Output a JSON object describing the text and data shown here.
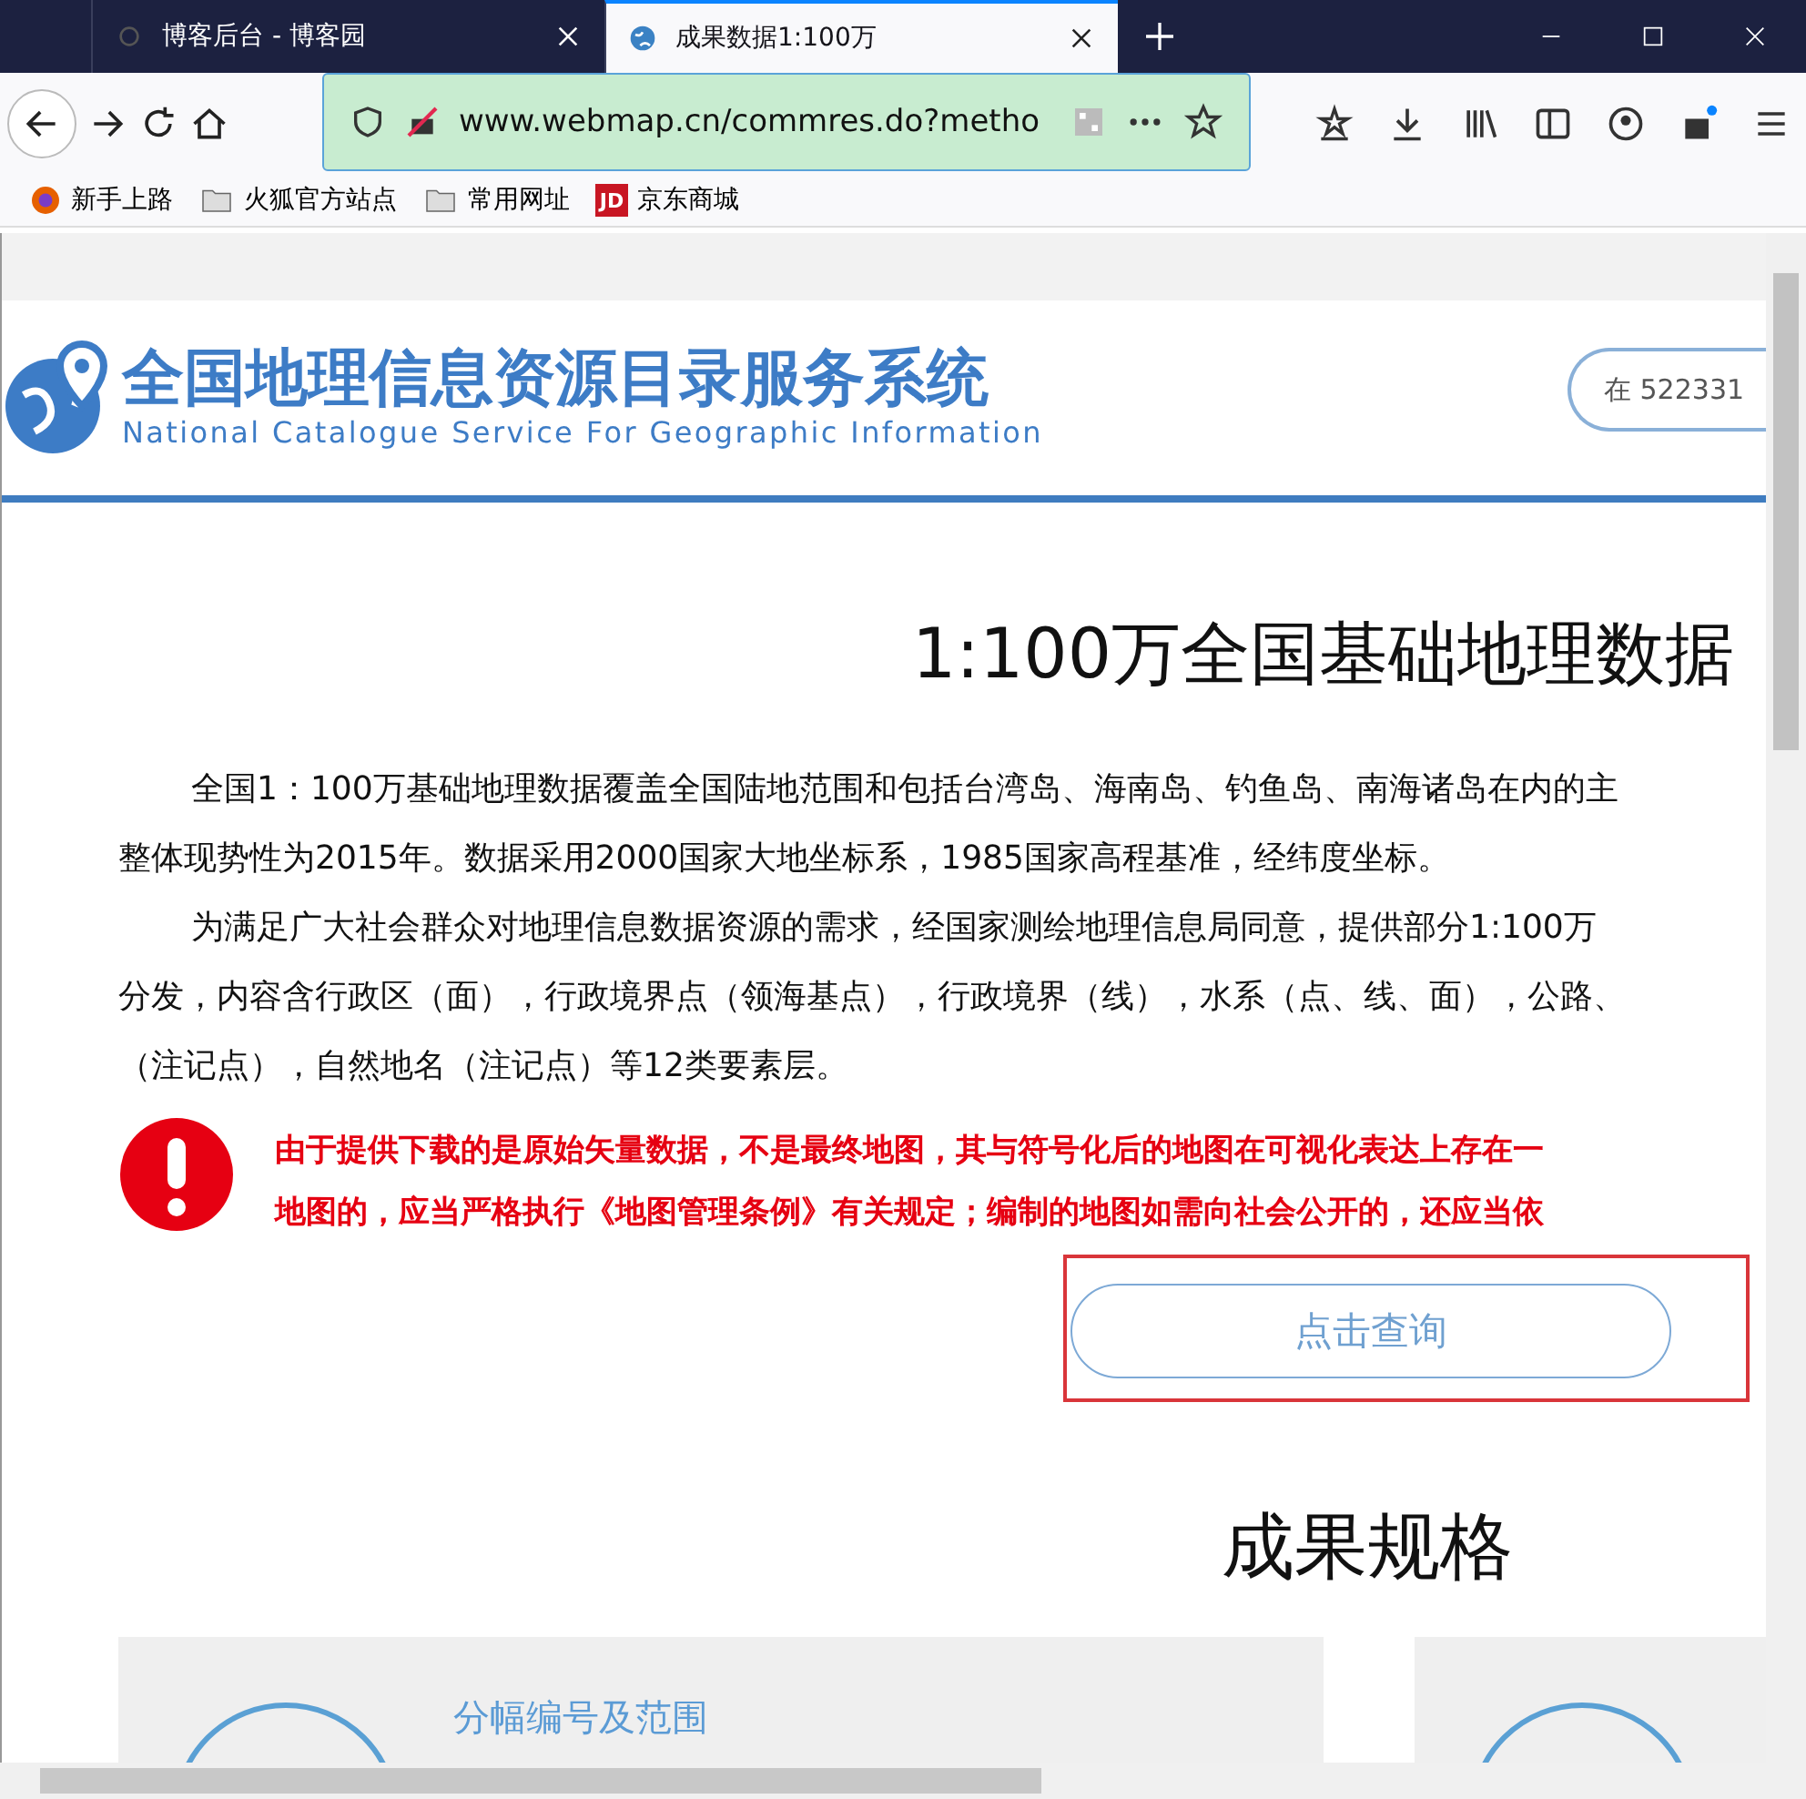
{
  "tabs": [
    {
      "label": "博客后台 - 博客园",
      "selected": false
    },
    {
      "label": "成果数据1:100万",
      "selected": true
    }
  ],
  "address_bar": {
    "url": "www.webmap.cn/commres.do?metho"
  },
  "bookmarks": [
    {
      "label": "新手上路",
      "kind": "firefox"
    },
    {
      "label": "火狐官方站点",
      "kind": "folder"
    },
    {
      "label": "常用网址",
      "kind": "folder"
    },
    {
      "label": "京东商城",
      "kind": "jd",
      "icon_text": "JD"
    }
  ],
  "site": {
    "title": "全国地理信息资源目录服务系统",
    "subtitle": "National Catalogue Service For Geographic Information",
    "search_placeholder": "在 522331"
  },
  "page": {
    "heading": "1:100万全国基础地理数据",
    "paragraphs": [
      [
        "全国1：100万基础地理数据覆盖全国陆地范围和包括台湾岛、海南岛、钓鱼岛、南海诸岛在内的主",
        "整体现势性为2015年。数据采用2000国家大地坐标系，1985国家高程基准，经纬度坐标。"
      ],
      [
        "为满足广大社会群众对地理信息数据资源的需求，经国家测绘地理信息局同意，提供部分1:100万",
        "分发，内容含行政区（面），行政境界点（领海基点），行政境界（线），水系（点、线、面），公路、",
        "（注记点），自然地名（注记点）等12类要素层。"
      ]
    ],
    "warning": [
      "由于提供下载的是原始矢量数据，不是最终地图，其与符号化后的地图在可视化表达上存在一",
      "地图的，应当严格执行《地图管理条例》有关规定；编制的地图如需向社会公开的，还应当依"
    ],
    "query_button": "点击查询",
    "section_title": "成果规格",
    "cards": [
      {
        "kind": "spec",
        "title": "分幅编号及范围"
      },
      {
        "kind": "spec"
      }
    ]
  }
}
